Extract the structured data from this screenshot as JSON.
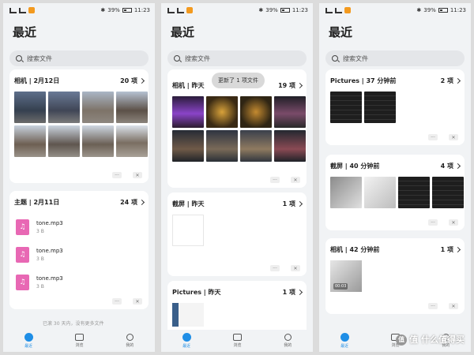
{
  "status": {
    "battery": "39%",
    "time": "11:23",
    "bluetooth": "✱"
  },
  "page_title": "最近",
  "search": {
    "placeholder": "搜索文件"
  },
  "footer": {
    "more": "···",
    "close": "✕",
    "partial_hint": "已滚 30 天内，没有更多文件"
  },
  "nav": {
    "recent": "最近",
    "browse": "浏览",
    "mine": "我的"
  },
  "panel1": {
    "card1": {
      "title": "相机 | 2月12日",
      "count": "20 项"
    },
    "card2": {
      "title": "主题 | 2月11日",
      "count": "24 项",
      "files": [
        {
          "name": "tone.mp3",
          "size": "3 B"
        },
        {
          "name": "tone.mp3",
          "size": "3 B"
        },
        {
          "name": "tone.mp3",
          "size": "3 B"
        }
      ]
    }
  },
  "panel2": {
    "toast": "更新了 1 项文件",
    "card1": {
      "title": "相机 | 昨天",
      "count": "19 项"
    },
    "card2": {
      "title": "截屏 | 昨天",
      "count": "1 项"
    },
    "card3": {
      "title": "Pictures | 昨天",
      "count": "1 项"
    }
  },
  "panel3": {
    "card1": {
      "title": "Pictures | 37 分钟前",
      "count": "2 项"
    },
    "card2": {
      "title": "截屏 | 40 分钟前",
      "count": "4 项"
    },
    "card3": {
      "title": "相机 | 42 分钟前",
      "count": "1 项",
      "video_time": "00:03"
    }
  },
  "watermark": "值 什么值得买",
  "colors": {
    "accent": "#1f8ee6",
    "music_icon": "#e868b4",
    "status_app_icon": "#f39a1f"
  },
  "icons": [
    "wifi-icon",
    "bluetooth-icon",
    "battery-icon",
    "search-icon",
    "chevron-right-icon",
    "music-file-icon",
    "clock-icon",
    "folder-icon",
    "user-icon",
    "more-icon",
    "close-icon"
  ]
}
